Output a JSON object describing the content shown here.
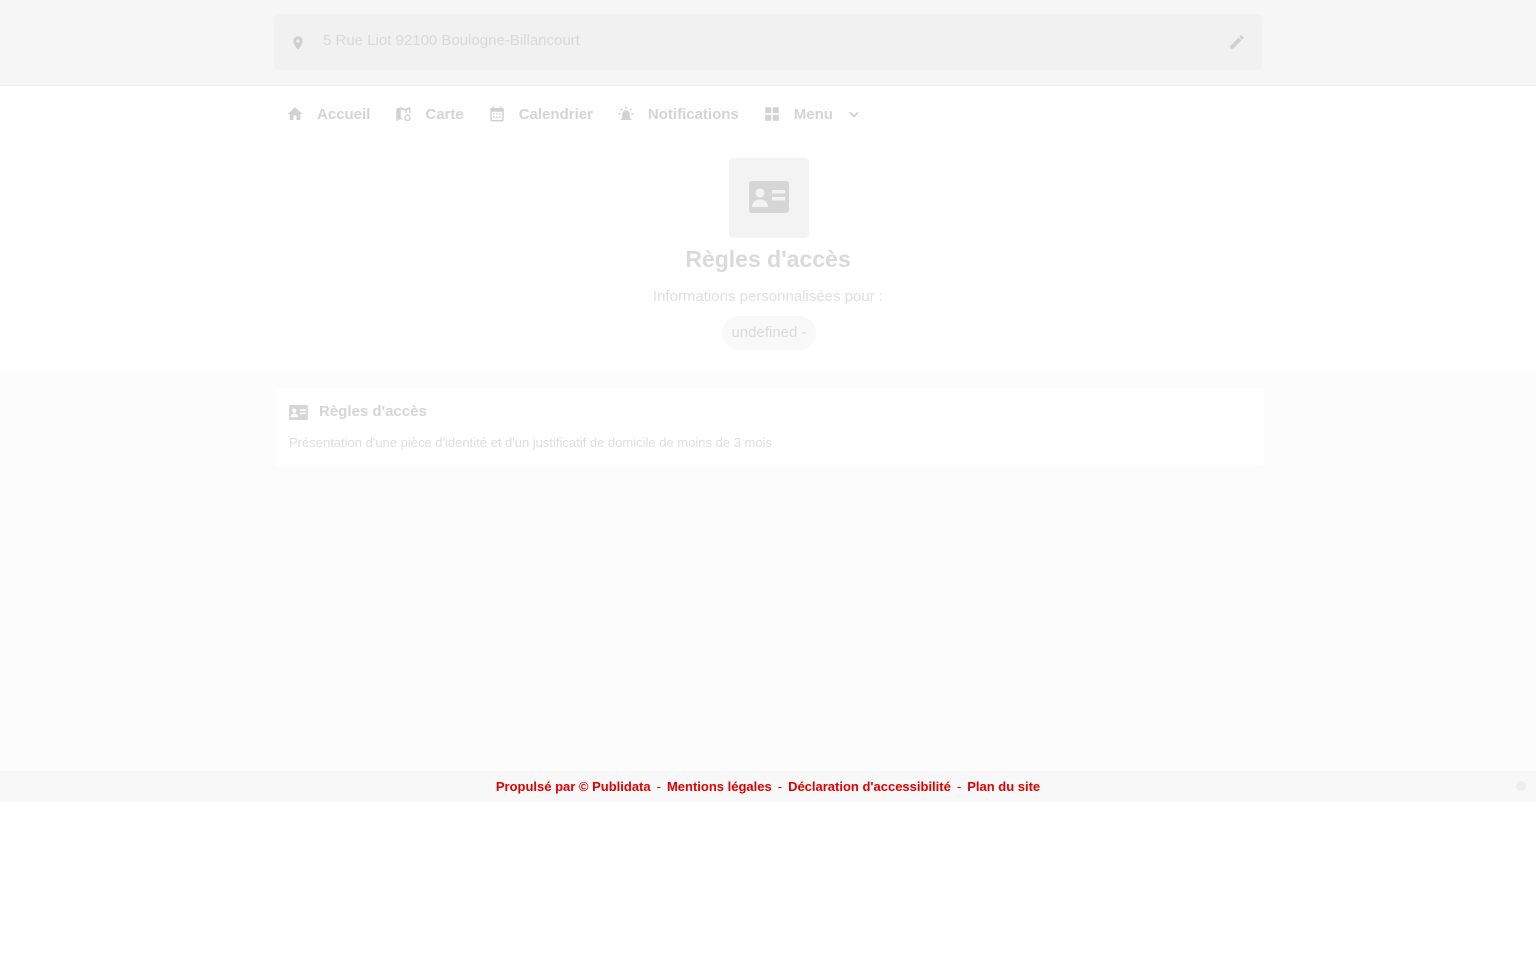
{
  "address": {
    "text": "5 Rue Liot 92100 Boulogne-Billancourt",
    "pin_icon": "location-pin-icon",
    "edit_icon": "pencil-icon"
  },
  "nav": {
    "items": [
      {
        "label": "Accueil",
        "icon": "home-icon"
      },
      {
        "label": "Carte",
        "icon": "map-icon"
      },
      {
        "label": "Calendrier",
        "icon": "calendar-icon"
      },
      {
        "label": "Notifications",
        "icon": "alarm-bell-icon"
      },
      {
        "label": "Menu",
        "icon": "grid-icon",
        "chevron": "chevron-down-icon"
      }
    ]
  },
  "hero": {
    "icon": "id-card-icon",
    "title": "Règles d'accès",
    "subtitle": "Informations personnalisées pour :",
    "pill": "undefined -"
  },
  "card": {
    "icon": "id-card-icon",
    "title": "Règles d'accès",
    "text": "Présentation d'une pièce d'identité et d'un justificatif de domicile de moins de 3 mois"
  },
  "footer": {
    "links": [
      "Propulsé par © Publidata",
      "Mentions légales",
      "Déclaration d'accessibilité",
      "Plan du site"
    ]
  },
  "colors": {
    "footer_link": "#e00000",
    "page_bg": "#fcfcfc"
  }
}
